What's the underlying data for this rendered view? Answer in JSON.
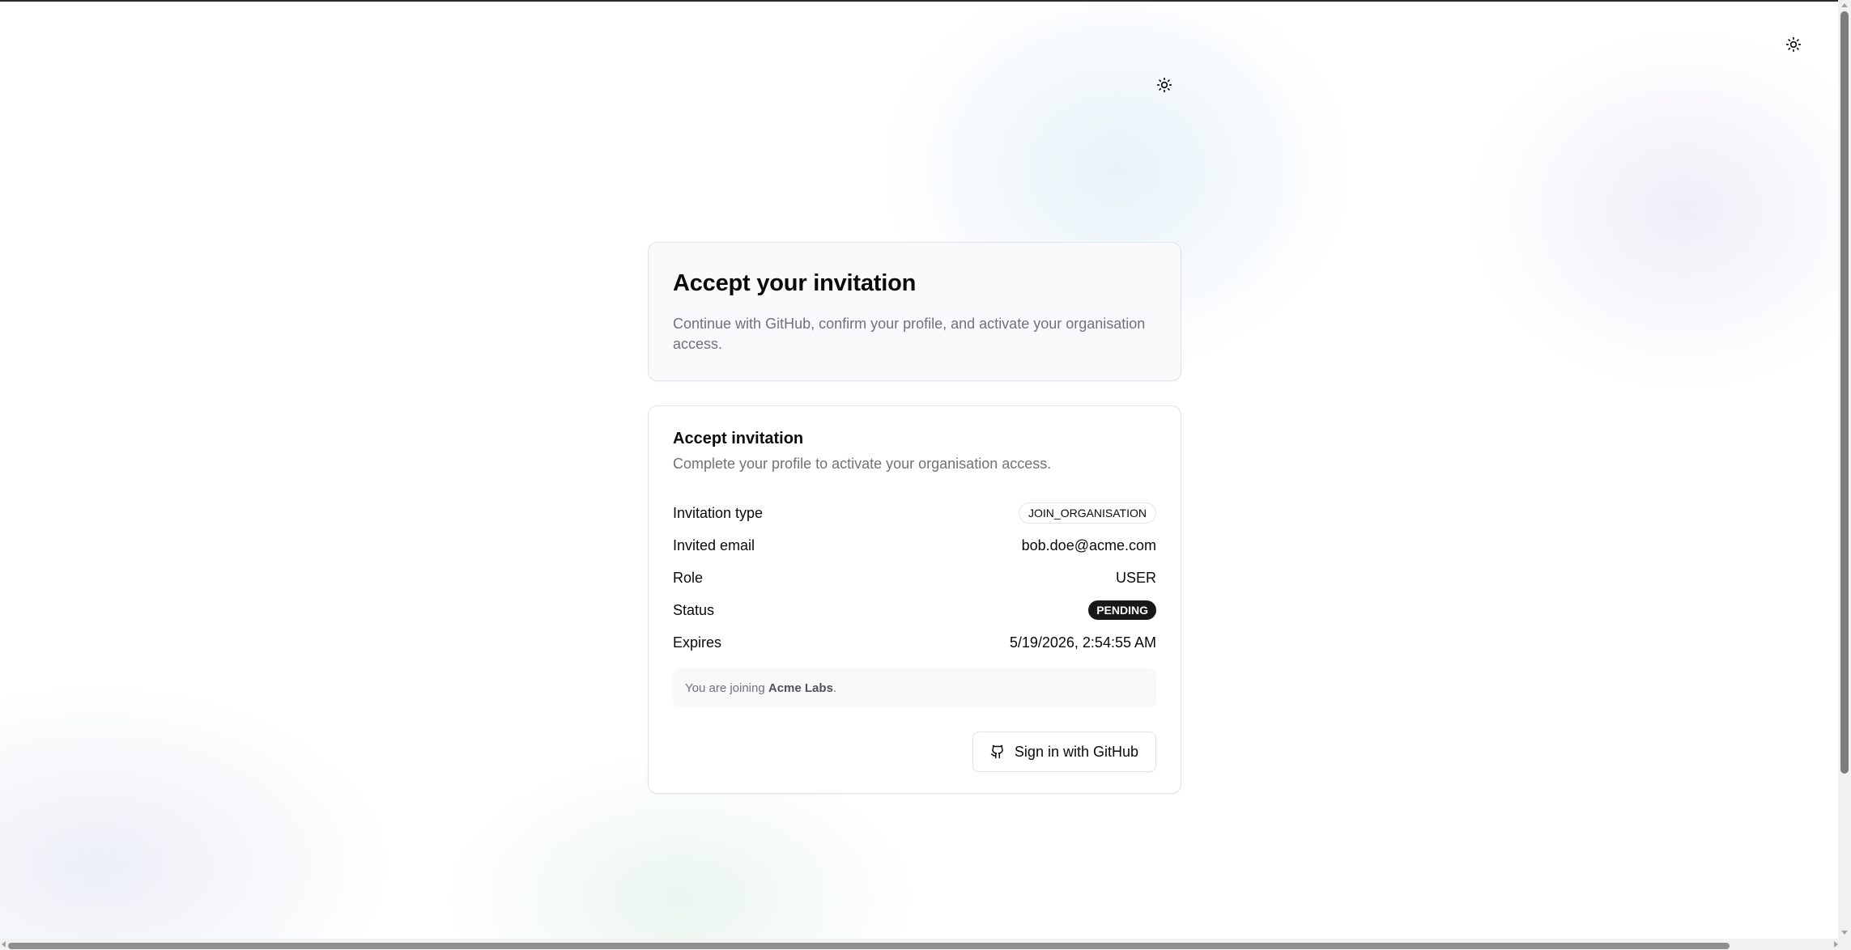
{
  "header": {
    "theme_toggle_icon": "sun-icon"
  },
  "hero": {
    "title": "Accept your invitation",
    "description": "Continue with GitHub, confirm your profile, and activate your organisation access."
  },
  "invitation": {
    "title": "Accept invitation",
    "description": "Complete your profile to activate your organisation access.",
    "details": {
      "type_label": "Invitation type",
      "type_value": "JOIN_ORGANISATION",
      "email_label": "Invited email",
      "email_value": "bob.doe@acme.com",
      "role_label": "Role",
      "role_value": "USER",
      "status_label": "Status",
      "status_value": "PENDING",
      "expires_label": "Expires",
      "expires_value": "5/19/2026, 2:54:55 AM"
    },
    "note": {
      "prefix": "You are joining ",
      "organisation": "Acme Labs",
      "suffix": "."
    },
    "sign_in_button": {
      "label": "Sign in with GitHub",
      "icon": "github-icon"
    }
  },
  "colors": {
    "text": "#0a0a0a",
    "muted": "#71717a",
    "border": "#e4e4e7",
    "badge_dark": "#18181b"
  }
}
